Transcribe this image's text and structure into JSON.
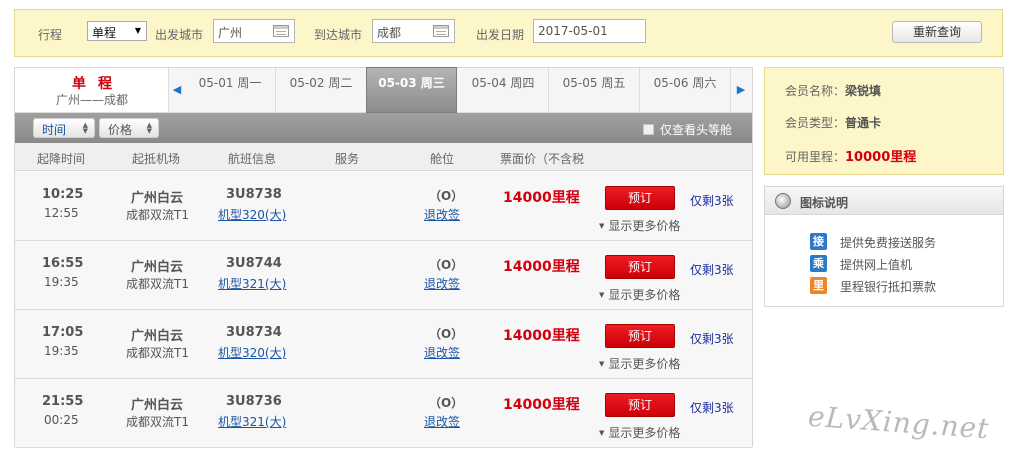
{
  "search": {
    "trip_label": "行程",
    "trip_value": "单程",
    "from_label": "出发城市",
    "from_value": "广州",
    "to_label": "到达城市",
    "to_value": "成都",
    "date_label": "出发日期",
    "date_value": "2017-05-01",
    "requery_label": "重新查询"
  },
  "trip": {
    "type": "单程",
    "route": "广州——成都"
  },
  "dates": [
    {
      "label": "05-01 周一",
      "active": false
    },
    {
      "label": "05-02 周二",
      "active": false
    },
    {
      "label": "05-03 周三",
      "active": true
    },
    {
      "label": "05-04 周四",
      "active": false
    },
    {
      "label": "05-05 周五",
      "active": false
    },
    {
      "label": "05-06 周六",
      "active": false
    }
  ],
  "filters": {
    "sort_time": "时间",
    "sort_price": "价格",
    "head_cabin_only": "仅查看头等舱"
  },
  "columns": {
    "time": "起降时间",
    "airport": "起抵机场",
    "flight": "航班信息",
    "service": "服务",
    "cabin": "舱位",
    "price": "票面价（不含税"
  },
  "flights": [
    {
      "dep_time": "10:25",
      "arr_time": "12:55",
      "dep_airport": "广州白云",
      "arr_airport": "成都双流T1",
      "flight_no": "3U8738",
      "model": "机型320(大)",
      "cabin": "（O）",
      "refund": "退改签",
      "price": "14000里程",
      "book": "预订",
      "remain": "仅剩3张",
      "more": "显示更多价格"
    },
    {
      "dep_time": "16:55",
      "arr_time": "19:35",
      "dep_airport": "广州白云",
      "arr_airport": "成都双流T1",
      "flight_no": "3U8744",
      "model": "机型321(大)",
      "cabin": "（O）",
      "refund": "退改签",
      "price": "14000里程",
      "book": "预订",
      "remain": "仅剩3张",
      "more": "显示更多价格"
    },
    {
      "dep_time": "17:05",
      "arr_time": "19:35",
      "dep_airport": "广州白云",
      "arr_airport": "成都双流T1",
      "flight_no": "3U8734",
      "model": "机型320(大)",
      "cabin": "（O）",
      "refund": "退改签",
      "price": "14000里程",
      "book": "预订",
      "remain": "仅剩3张",
      "more": "显示更多价格"
    },
    {
      "dep_time": "21:55",
      "arr_time": "00:25",
      "dep_airport": "广州白云",
      "arr_airport": "成都双流T1",
      "flight_no": "3U8736",
      "model": "机型321(大)",
      "cabin": "（O）",
      "refund": "退改签",
      "price": "14000里程",
      "book": "预订",
      "remain": "仅剩3张",
      "more": "显示更多价格"
    }
  ],
  "member": {
    "name_label": "会员名称：",
    "name": "梁锐填",
    "type_label": "会员类型：",
    "type": "普通卡",
    "miles_label": "可用里程：",
    "miles": "10000里程"
  },
  "legend": {
    "title": "图标说明",
    "items": [
      {
        "badge": "接",
        "text": "提供免费接送服务",
        "color": "#2c78c9"
      },
      {
        "badge": "乘",
        "text": "提供网上值机",
        "color": "#2c78c9"
      },
      {
        "badge": "里",
        "text": "里程银行抵扣票款",
        "color": "#f08524"
      }
    ]
  },
  "watermark": "eLvXing.net",
  "colors": {
    "accent_red": "#d2000f",
    "link_blue": "#1a55a6",
    "panel_yellow": "#fdf6c9"
  }
}
